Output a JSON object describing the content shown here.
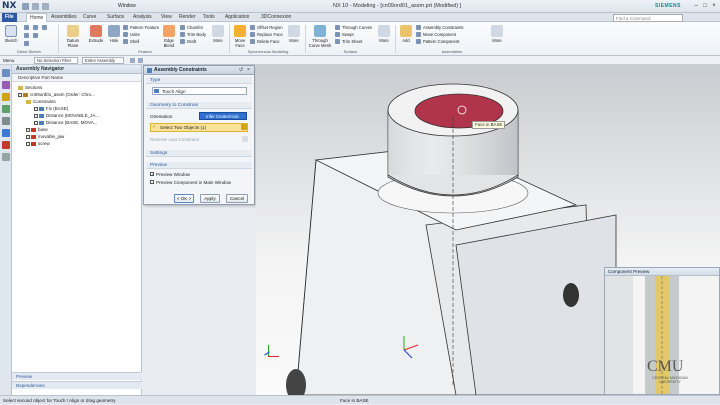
{
  "titlebar": {
    "logo": "NX",
    "quick_access": "Window",
    "title": "NX 10 - Modeling - [cn09ord01_assm.prt (Modified) ]",
    "brand": "SIEMENS",
    "search_placeholder": "Find a Command"
  },
  "tabs": [
    "File",
    "Home",
    "Assemblies",
    "Curve",
    "Surface",
    "Analysis",
    "View",
    "Render",
    "Tools",
    "Application",
    "3DConnexion"
  ],
  "ribbon": {
    "direct_sketch": {
      "sketch": "Sketch",
      "group": "Direct Sketch"
    },
    "feature": {
      "datum": "Datum Plane",
      "extrude": "Extrude",
      "hole": "Hole",
      "pattern_feature": "Pattern Feature",
      "unite": "Unite",
      "shell": "Shell",
      "edge_blend": "Edge Blend",
      "chamfer": "Chamfer",
      "trim_body": "Trim Body",
      "draft": "Draft",
      "more": "More",
      "group": "Feature"
    },
    "sync": {
      "move_face": "Move Face",
      "offset_region": "Offset Region",
      "replace_face": "Replace Face",
      "delete_face": "Delete Face",
      "more": "More",
      "group": "Synchronous Modeling"
    },
    "surface": {
      "through_curve_mesh": "Through Curve Mesh",
      "through_curves": "Through Curves",
      "swept": "Swept",
      "bounded": "Bounded Plane",
      "trim_sheet": "Trim Sheet",
      "more": "More",
      "group": "Surface"
    },
    "assemblies": {
      "add": "Add",
      "assembly_constraints": "Assembly Constraints",
      "move_component": "Move Component",
      "pattern_component": "Pattern Component",
      "more": "More",
      "group": "Assemblies"
    }
  },
  "toolbar2": {
    "menu": "Menu",
    "filter": "No Selection Filter",
    "scope": "Entire Assembly"
  },
  "navigator": {
    "title": "Assembly Navigator",
    "column": "Descriptive Part Name",
    "rows": [
      {
        "label": "Sections",
        "kind": "folder"
      },
      {
        "label": "cn09ord01_assm (Order: Chro...",
        "kind": "assm"
      },
      {
        "label": "Constraints",
        "kind": "folder"
      },
      {
        "label": "Fix (BASE)",
        "kind": "con"
      },
      {
        "label": "Distance (MOVABLE_JA...",
        "kind": "con"
      },
      {
        "label": "Distance (BASE, MOVA...",
        "kind": "con"
      },
      {
        "label": "base",
        "kind": "part"
      },
      {
        "label": "movable_jaw",
        "kind": "part"
      },
      {
        "label": "screw",
        "kind": "part"
      }
    ],
    "footer_preview": "Preview",
    "footer_deps": "Dependencies"
  },
  "dialog": {
    "title": "Assembly Constraints",
    "type_section": "Type",
    "type_value": "Touch Align",
    "geom_section": "Geometry to Constrain",
    "orientation_label": "Orientation",
    "orientation_value": "Infer Center/Axis",
    "select_label": "Select Two Objects (1)",
    "reverse_label": "Reverse Last Constraint",
    "settings_section": "Settings",
    "preview_section": "Preview",
    "preview_window": "Preview Window",
    "preview_main": "Preview Component in Main Window",
    "ok": "< OK >",
    "apply": "Apply",
    "cancel": "Cancel"
  },
  "viewport": {
    "tooltip": "Face in BASE"
  },
  "component_preview": {
    "title": "Component Preview",
    "watermark_main": "CMU",
    "watermark_sub": "CENTRAL MICHIGAN UNIVERSITY"
  },
  "status": {
    "left": "Select second object for Touch / Align or drag geometry",
    "center": "Face in BASE"
  },
  "colors": {
    "accent": "#2b5aa0",
    "selection": "#f0a020",
    "part_body": "#eceff1",
    "bore": "#b0344a"
  }
}
